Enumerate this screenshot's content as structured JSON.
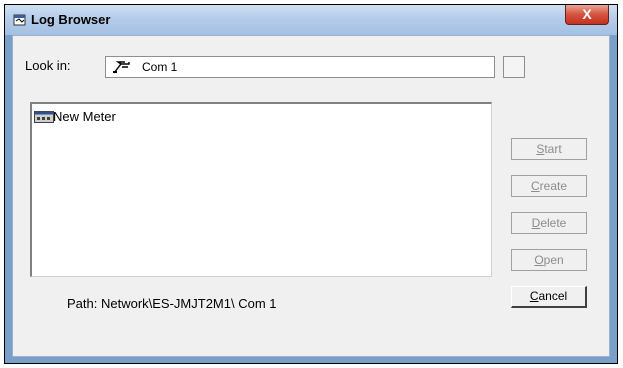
{
  "window": {
    "title": "Log Browser",
    "close_label": "X"
  },
  "look_in": {
    "label": "Look in:",
    "value": "Com 1"
  },
  "list": {
    "items": [
      {
        "label": "New Meter"
      }
    ]
  },
  "buttons": {
    "start": {
      "label_accel": "S",
      "label_rest": "tart"
    },
    "create": {
      "label_accel": "C",
      "label_rest": "reate"
    },
    "delete": {
      "label_accel": "D",
      "label_rest": "elete"
    },
    "open": {
      "label_accel": "O",
      "label_rest": "pen"
    },
    "cancel": {
      "label_accel": "C",
      "label_rest": "ancel"
    }
  },
  "path": {
    "text": "Path: Network\\ES-JMJT2M1\\ Com 1"
  },
  "colors": {
    "titlebar": "#b5cde9",
    "close_button": "#d5533f",
    "dialog_background": "#f0f0f0"
  },
  "icons": {
    "title": "log-browser-icon",
    "look_in": "port-icon",
    "list_item": "meter-icon"
  }
}
